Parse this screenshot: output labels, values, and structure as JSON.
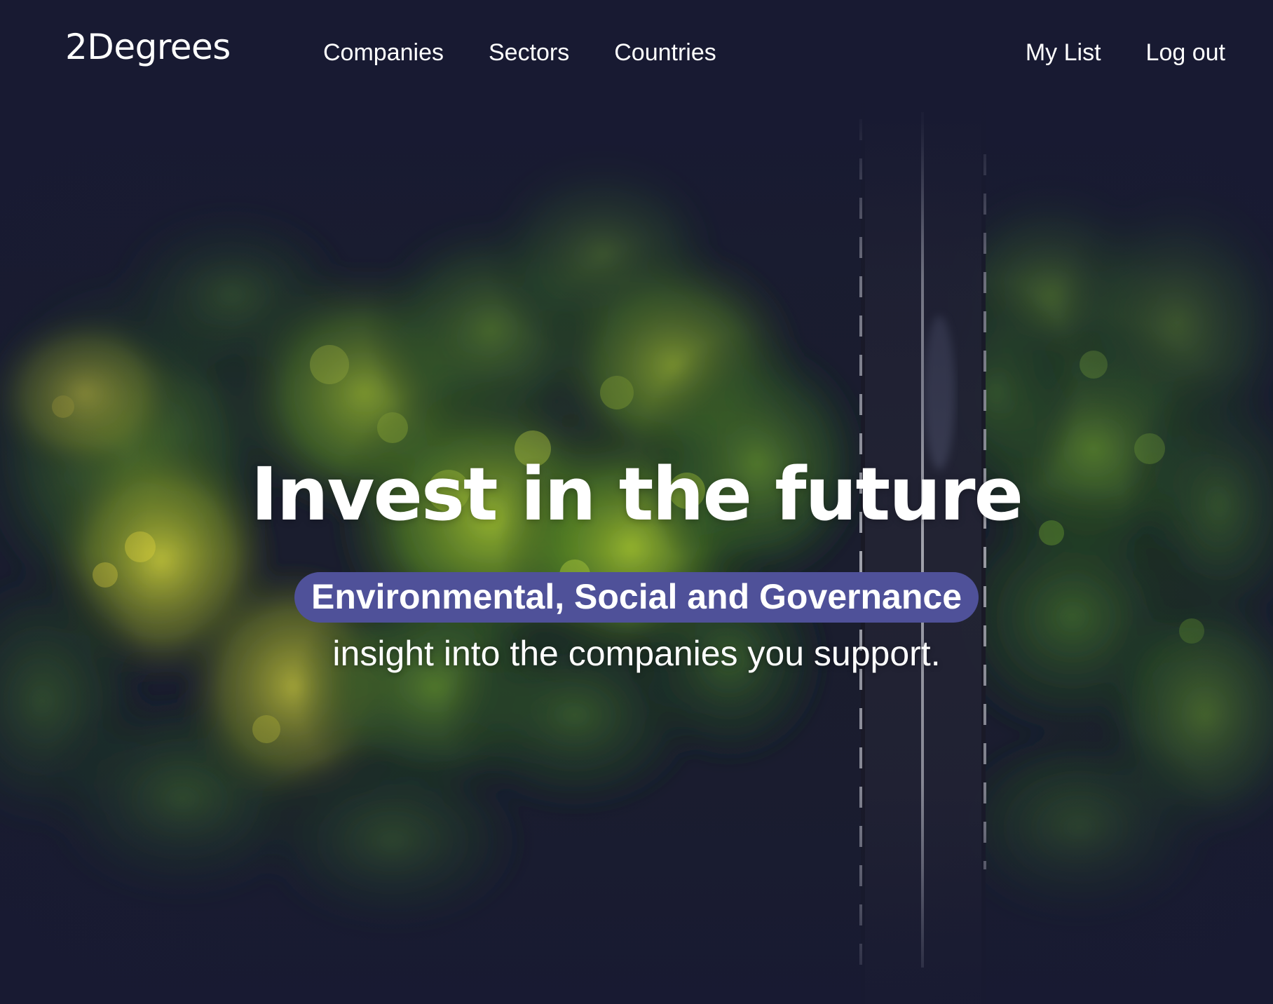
{
  "brand": {
    "name": "2Degrees"
  },
  "nav": {
    "main": [
      {
        "label": "Companies"
      },
      {
        "label": "Sectors"
      },
      {
        "label": "Countries"
      }
    ],
    "user": [
      {
        "label": "My List"
      },
      {
        "label": "Log out"
      }
    ]
  },
  "hero": {
    "title": "Invest in the future",
    "highlight": "Environmental, Social and Governance",
    "subtitle": "insight into the companies you support.",
    "background_image": "aerial-forest-road-photo"
  },
  "colors": {
    "page_background": "#181a32",
    "highlight_pill": "#4f5199",
    "text": "#ffffff"
  }
}
